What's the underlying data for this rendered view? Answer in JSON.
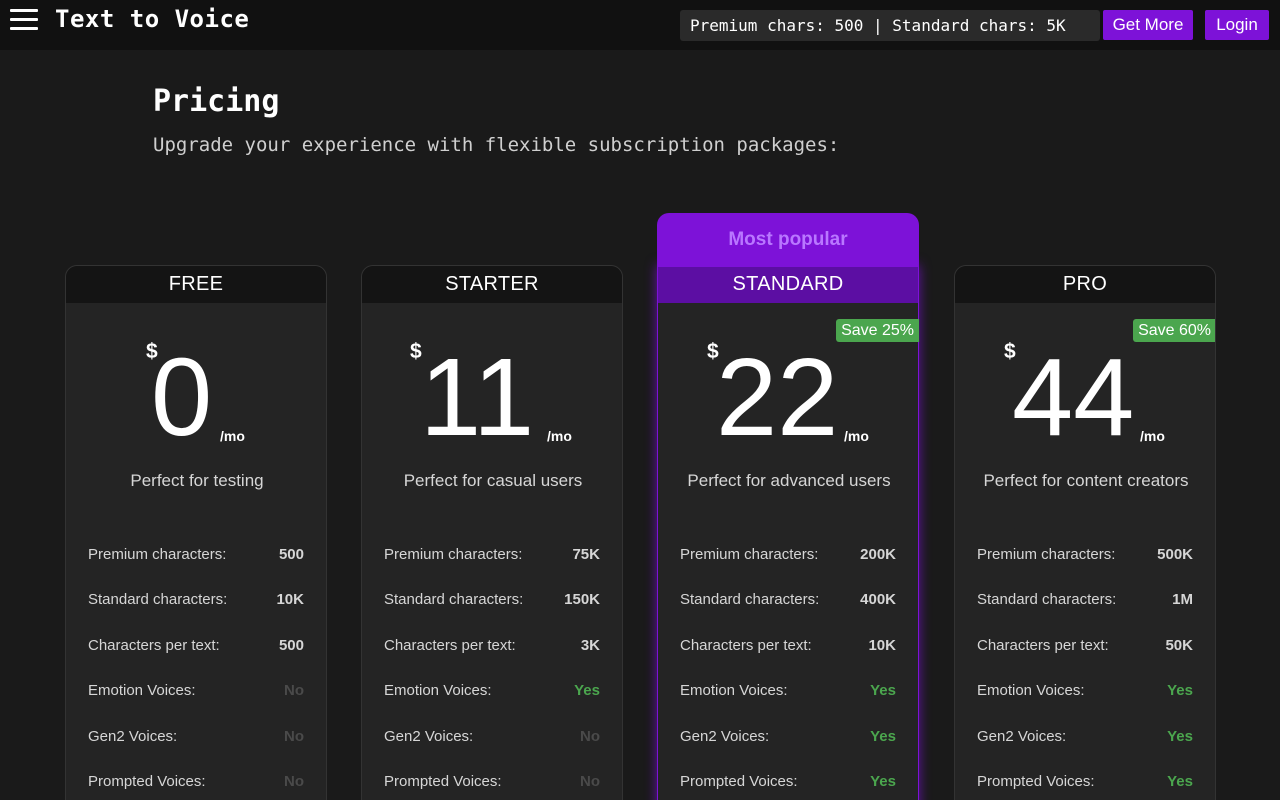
{
  "header": {
    "app_title": "Text to Voice",
    "chars_info": "Premium chars: 500 | Standard chars: 5K",
    "get_more_label": "Get More",
    "login_label": "Login"
  },
  "page": {
    "title": "Pricing",
    "subtitle": "Upgrade your experience with flexible subscription packages:"
  },
  "plans": [
    {
      "name": "FREE",
      "currency": "$",
      "price": "0",
      "period": "/mo",
      "tagline": "Perfect for testing",
      "features": [
        {
          "label": "Premium characters:",
          "value": "500"
        },
        {
          "label": "Standard characters:",
          "value": "10K"
        },
        {
          "label": "Characters per text:",
          "value": "500"
        },
        {
          "label": "Emotion Voices:",
          "value": "No"
        },
        {
          "label": "Gen2 Voices:",
          "value": "No"
        },
        {
          "label": "Prompted Voices:",
          "value": "No"
        }
      ]
    },
    {
      "name": "STARTER",
      "currency": "$",
      "price": "11",
      "period": "/mo",
      "tagline": "Perfect for casual users",
      "features": [
        {
          "label": "Premium characters:",
          "value": "75K"
        },
        {
          "label": "Standard characters:",
          "value": "150K"
        },
        {
          "label": "Characters per text:",
          "value": "3K"
        },
        {
          "label": "Emotion Voices:",
          "value": "Yes"
        },
        {
          "label": "Gen2 Voices:",
          "value": "No"
        },
        {
          "label": "Prompted Voices:",
          "value": "No"
        }
      ]
    },
    {
      "name": "STANDARD",
      "popular_label": "Most popular",
      "save_badge": "Save 25%",
      "currency": "$",
      "price": "22",
      "period": "/mo",
      "tagline": "Perfect for advanced users",
      "features": [
        {
          "label": "Premium characters:",
          "value": "200K"
        },
        {
          "label": "Standard characters:",
          "value": "400K"
        },
        {
          "label": "Characters per text:",
          "value": "10K"
        },
        {
          "label": "Emotion Voices:",
          "value": "Yes"
        },
        {
          "label": "Gen2 Voices:",
          "value": "Yes"
        },
        {
          "label": "Prompted Voices:",
          "value": "Yes"
        }
      ]
    },
    {
      "name": "PRO",
      "save_badge": "Save 60%",
      "currency": "$",
      "price": "44",
      "period": "/mo",
      "tagline": "Perfect for content creators",
      "features": [
        {
          "label": "Premium characters:",
          "value": "500K"
        },
        {
          "label": "Standard characters:",
          "value": "1M"
        },
        {
          "label": "Characters per text:",
          "value": "50K"
        },
        {
          "label": "Emotion Voices:",
          "value": "Yes"
        },
        {
          "label": "Gen2 Voices:",
          "value": "Yes"
        },
        {
          "label": "Prompted Voices:",
          "value": "Yes"
        }
      ]
    }
  ],
  "colors": {
    "accent": "#7d12d8",
    "yes": "#4ba64e",
    "no": "#4a4a4a",
    "background": "#1a1a1a"
  }
}
